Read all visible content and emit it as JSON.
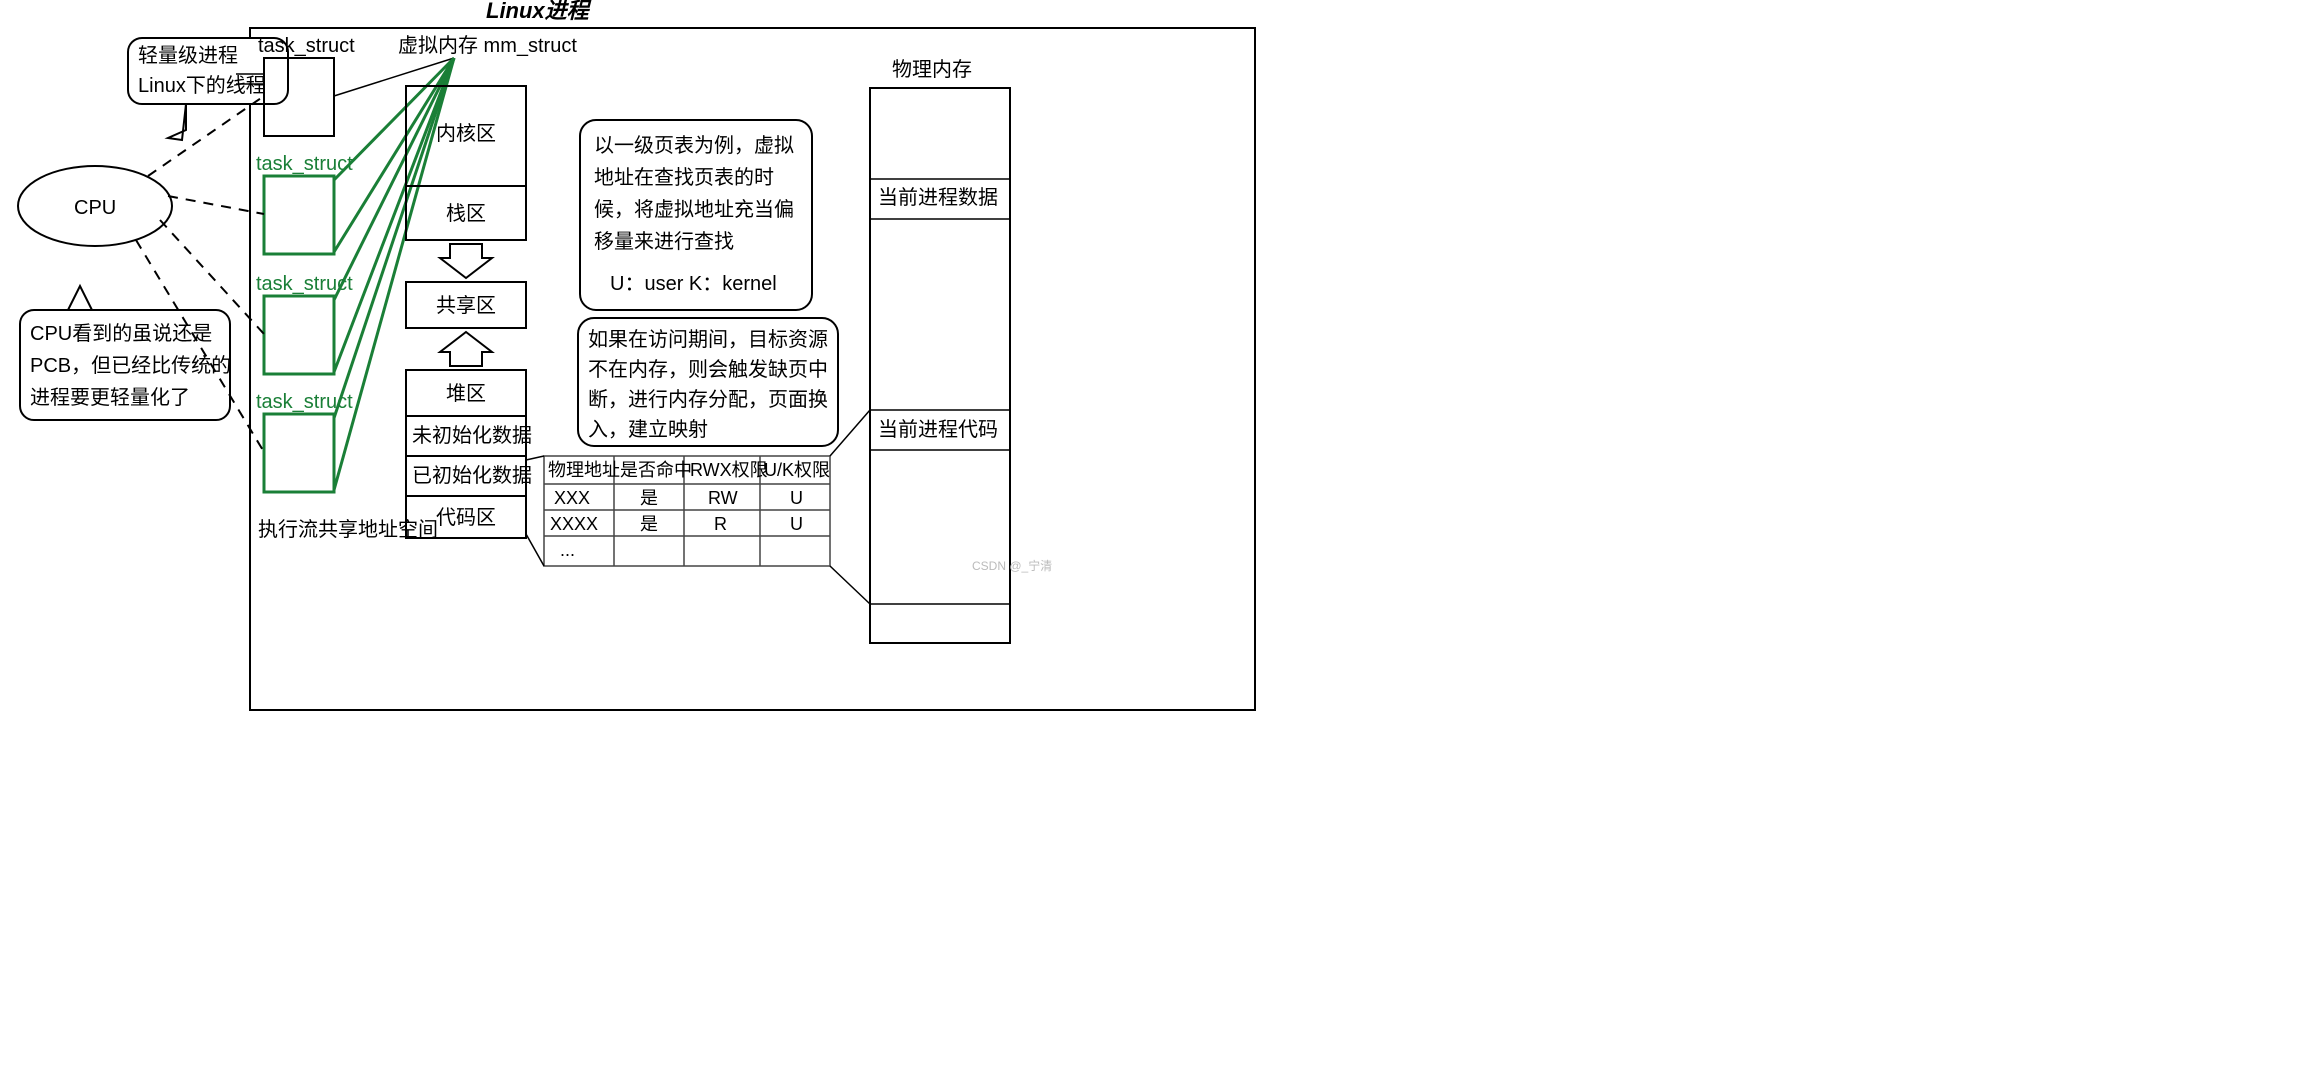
{
  "title": "Linux进程",
  "cpu": {
    "label": "CPU"
  },
  "bubble_thread": {
    "line1": "轻量级进程",
    "line2": "Linux下的线程"
  },
  "bubble_cpu_note": {
    "line1": "CPU看到的虽说还是",
    "line2": "PCB，但已经比传统的",
    "line3": "进程要更轻量化了"
  },
  "task_structs": {
    "label_black": "task_struct",
    "label_green_1": "task_struct",
    "label_green_2": "task_struct",
    "label_green_3": "task_struct"
  },
  "exec_caption": "执行流共享地址空间",
  "mm_label": "虚拟内存 mm_struct",
  "vm_segments": {
    "kernel": "内核区",
    "stack": "栈区",
    "shared": "共享区",
    "heap": "堆区",
    "bss": "未初始化数据",
    "data": "已初始化数据",
    "text": "代码区"
  },
  "note_pagetable": {
    "l1": "以一级页表为例，虚拟",
    "l2": "地址在查找页表的时",
    "l3": "候，将虚拟地址充当偏",
    "l4": "移量来进行查找",
    "l5": "U：user  K：kernel"
  },
  "note_fault": {
    "l1": "如果在访问期间，目标资源",
    "l2": "不在内存，则会触发缺页中",
    "l3": "断，进行内存分配，页面换",
    "l4": "入，建立映射"
  },
  "page_table": {
    "headers": {
      "c1": "物理地址",
      "c2": "是否命中",
      "c3": "RWX权限",
      "c4": "U/K权限"
    },
    "rows": [
      {
        "c1": "XXX",
        "c2": "是",
        "c3": "RW",
        "c4": "U"
      },
      {
        "c1": "XXXX",
        "c2": "是",
        "c3": "R",
        "c4": "U"
      },
      {
        "c1": "...",
        "c2": "",
        "c3": "",
        "c4": ""
      }
    ]
  },
  "phys_mem": {
    "title": "物理内存",
    "data_seg": "当前进程数据",
    "code_seg": "当前进程代码"
  },
  "watermark": "CSDN @_宁清"
}
